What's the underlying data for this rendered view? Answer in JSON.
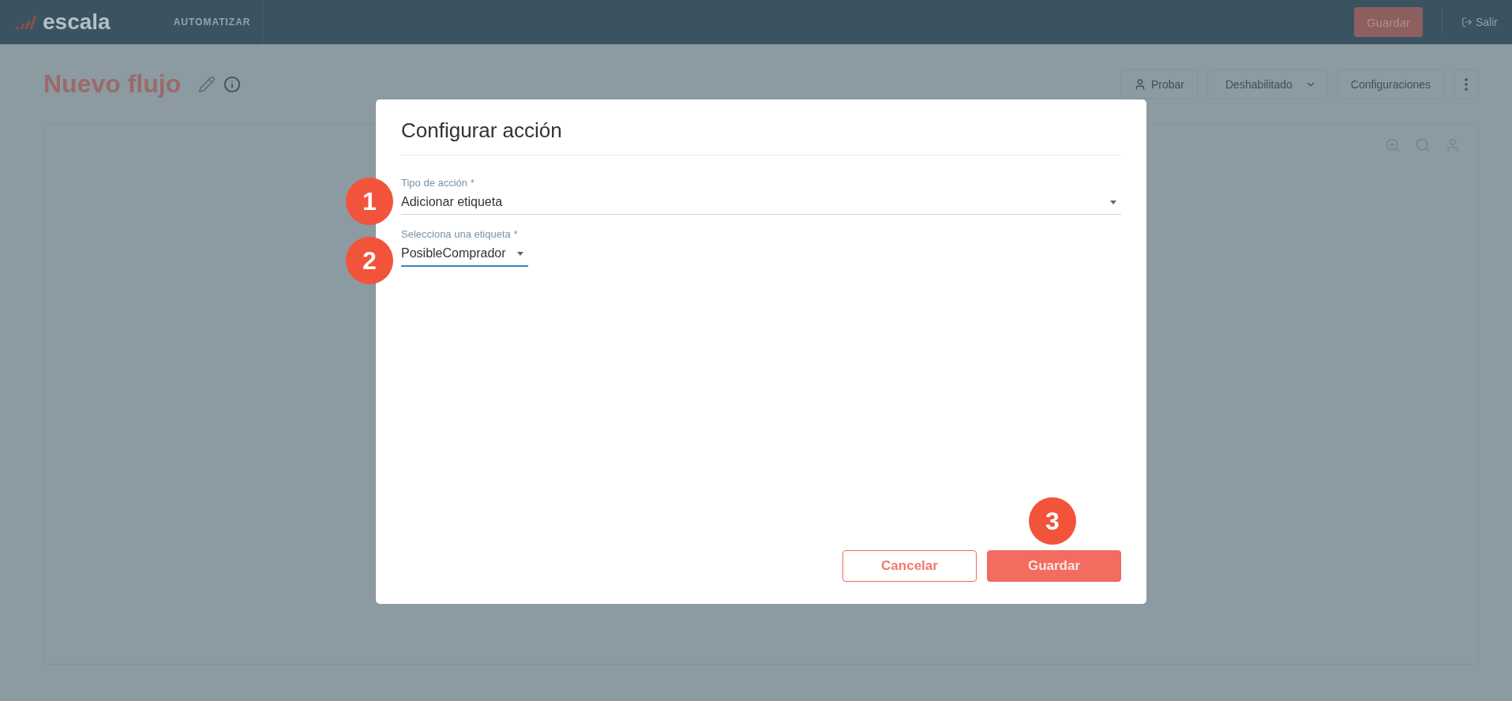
{
  "header": {
    "logo": "escala",
    "nav": "AUTOMATIZAR",
    "save_button": "Guardar",
    "logout": "Salir"
  },
  "page": {
    "title": "Nuevo flujo",
    "toolbar": [
      {
        "label": "Probar",
        "kind": "test"
      },
      {
        "label": "Deshabilitado",
        "kind": "dropdown"
      },
      {
        "label": "Configuraciones",
        "kind": "plain"
      }
    ]
  },
  "modal": {
    "title": "Configurar acción",
    "fields": [
      {
        "label": "Tipo de acción *",
        "value": "Adicionar etiqueta",
        "kind": "full",
        "focused": false
      },
      {
        "label": "Selecciona una etiqueta *",
        "value": "PosibleComprador",
        "kind": "compact",
        "focused": true
      }
    ],
    "buttons": [
      {
        "label": "Cancelar",
        "kind": "secondary"
      },
      {
        "label": "Guardar",
        "kind": "primary"
      }
    ]
  },
  "step_markers": [
    "1",
    "2",
    "3"
  ]
}
